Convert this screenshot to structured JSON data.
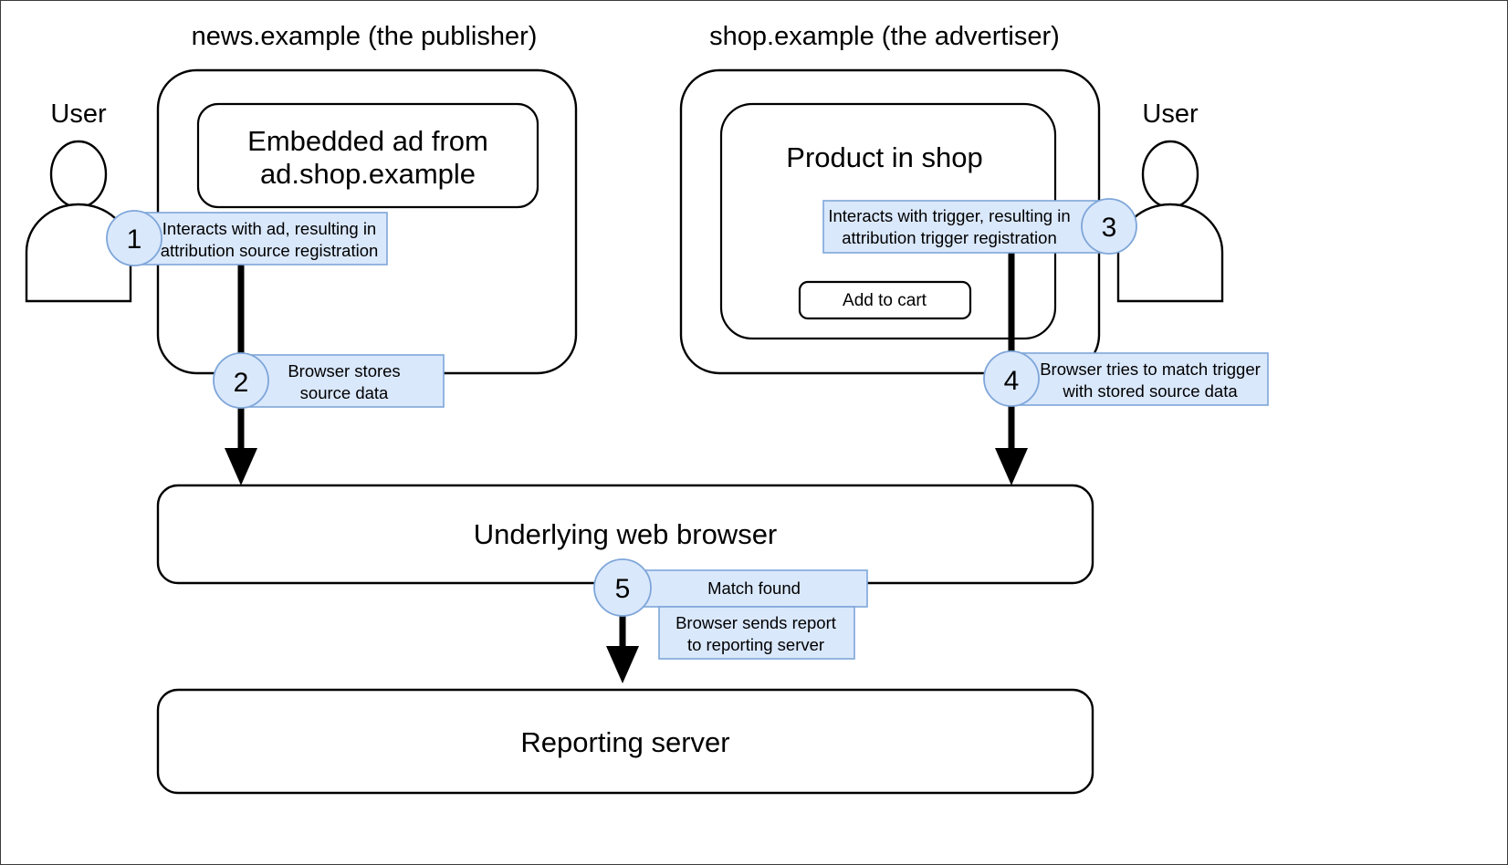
{
  "diagram": {
    "title_publisher": "news.example (the publisher)",
    "title_advertiser": "shop.example (the advertiser)",
    "user_left": "User",
    "user_right": "User",
    "embedded_ad_line1": "Embedded ad from",
    "embedded_ad_line2": "ad.shop.example",
    "product_in_shop": "Product in shop",
    "add_to_cart": "Add to cart",
    "underlying_browser": "Underlying web browser",
    "reporting_server": "Reporting server"
  },
  "steps": [
    {
      "number": "1",
      "line1": "Interacts with ad, resulting in",
      "line2": "attribution source registration"
    },
    {
      "number": "2",
      "line1": "Browser stores",
      "line2": "source data"
    },
    {
      "number": "3",
      "line1": "Interacts with trigger, resulting in",
      "line2": "attribution trigger registration"
    },
    {
      "number": "4",
      "line1": "Browser tries to match trigger",
      "line2": "with stored source data"
    },
    {
      "number": "5",
      "line1": "Match found",
      "line2": "",
      "extra_line1": "Browser sends report",
      "extra_line2": "to reporting server"
    }
  ],
  "colors": {
    "label_fill": "#dae8fc",
    "label_stroke": "#7ea6d9",
    "shape_stroke": "#000000",
    "background": "#ffffff",
    "frame_border": "#3c3c3c"
  }
}
